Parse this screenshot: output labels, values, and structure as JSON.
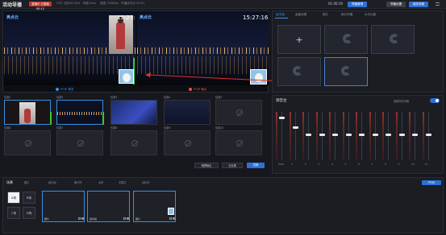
{
  "topbar": {
    "title": "活动导播",
    "badge": "直播中 已直播00:12",
    "stats": [
      "CPU 占用34.00%",
      "网络 8ms",
      "速度 700Kb/s",
      "开播总时长 00:01"
    ],
    "time": "01:00:19",
    "buttons": [
      "导播管理",
      "导播设置",
      "保存场景"
    ]
  },
  "preview": {
    "pvw_logo": "奥点云",
    "pgm_logo": "奥点云",
    "pvw_time": "15:27:16",
    "pgm_time": "15:27:16",
    "pvw_label": "PVW 预览",
    "pgm_label": "PGM 输出",
    "pgm_zoom": "1.0"
  },
  "fxpanel": {
    "tabs": [
      "画中画",
      "画面效果",
      "图片",
      "倒计时器",
      "水印功能"
    ],
    "add_symbol": "+"
  },
  "media": {
    "sources": [
      {
        "label": "信源1",
        "kind": "video"
      },
      {
        "label": "信源2",
        "kind": "video"
      },
      {
        "label": "信源3",
        "kind": "image"
      },
      {
        "label": "信源4",
        "kind": "image"
      },
      {
        "label": "信源5",
        "kind": "empty"
      },
      {
        "label": "信源6",
        "kind": "empty"
      },
      {
        "label": "信源7",
        "kind": "empty"
      },
      {
        "label": "信源8",
        "kind": "empty"
      },
      {
        "label": "信源9",
        "kind": "empty"
      },
      {
        "label": "信源10",
        "kind": "empty"
      }
    ],
    "footer_select1": "横屏输出",
    "footer_select2": "无效果",
    "footer_button": "切换"
  },
  "mixer": {
    "title": "调音台",
    "toggle_label": "音频同步切换",
    "channels": [
      {
        "name": "PGM",
        "level": 0.9
      },
      {
        "name": "1",
        "level": 0.7
      },
      {
        "name": "2",
        "level": 0.55
      },
      {
        "name": "3",
        "level": 0.55
      },
      {
        "name": "4",
        "level": 0.55
      },
      {
        "name": "5",
        "level": 0.55
      },
      {
        "name": "6",
        "level": 0.55
      },
      {
        "name": "7",
        "level": 0.55
      },
      {
        "name": "8",
        "level": 0.55
      },
      {
        "name": "9",
        "level": 0.55
      },
      {
        "name": "10",
        "level": 0.55
      },
      {
        "name": "11",
        "level": 0.55
      }
    ]
  },
  "scenes": {
    "title": "场景",
    "tabs": [
      "图片",
      "画中画",
      "倒计时",
      "水印",
      "字幕栏",
      "台标字"
    ],
    "scene_buttons": [
      "A场",
      "B场",
      "C场",
      "D场"
    ],
    "cards": [
      {
        "label": "图片"
      },
      {
        "label": "画中画"
      },
      {
        "label": "图片"
      }
    ],
    "pvw_button": "PVW"
  }
}
